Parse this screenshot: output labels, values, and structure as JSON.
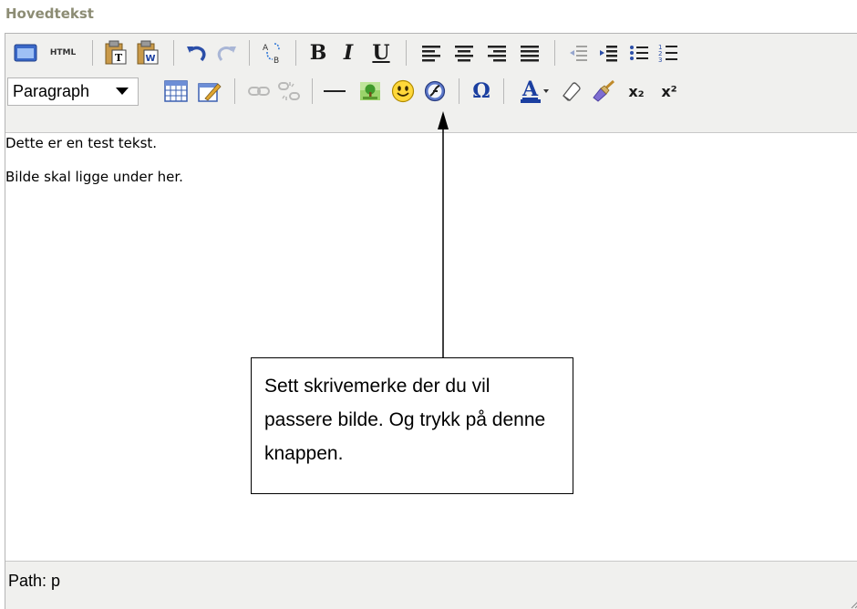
{
  "field": {
    "label": "Hovedtekst"
  },
  "toolbar": {
    "html_label": "HTML",
    "bold_label": "B",
    "italic_label": "I",
    "underline_label": "U",
    "block_format": {
      "selected": "Paragraph"
    },
    "omega_label": "Ω",
    "fontcolor_label": "A",
    "superscript_label": "x²",
    "subscript_label": "x₂"
  },
  "content": {
    "paragraphs": [
      "Dette er en test tekst.",
      "Bilde skal ligge under her."
    ]
  },
  "statusbar": {
    "path": "Path: p"
  },
  "callout": {
    "text": "Sett skrivemerke der du vil passere bilde. Og trykk på denne knappen."
  },
  "colors": {
    "label": "#8c8c74",
    "toolbar_bg": "#f0f0ee",
    "toolbar_icons": "#2b4ea8"
  }
}
